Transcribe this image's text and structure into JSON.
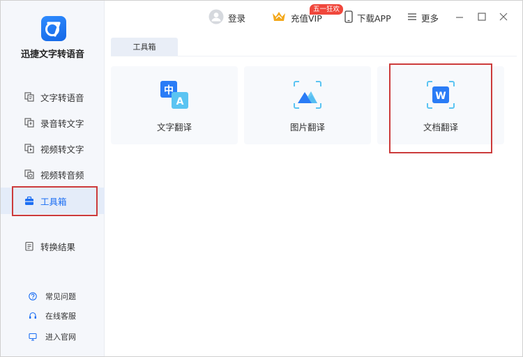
{
  "app": {
    "name": "迅捷文字转语音"
  },
  "sidebar": {
    "items": [
      {
        "label": "文字转语音",
        "icon": "text-to-speech-icon"
      },
      {
        "label": "录音转文字",
        "icon": "recording-to-text-icon"
      },
      {
        "label": "视频转文字",
        "icon": "video-to-text-icon"
      },
      {
        "label": "视频转音频",
        "icon": "video-to-audio-icon"
      },
      {
        "label": "工具箱",
        "icon": "toolbox-icon",
        "active": true
      },
      {
        "label": "转换结果",
        "icon": "conversion-result-icon"
      }
    ],
    "help": [
      {
        "label": "常见问题",
        "icon": "question-icon"
      },
      {
        "label": "在线客服",
        "icon": "headset-icon"
      },
      {
        "label": "进入官网",
        "icon": "monitor-icon"
      }
    ]
  },
  "header": {
    "login": "登录",
    "vip": "充值VIP",
    "promo_badge": "五一狂欢",
    "download": "下载APP",
    "more": "更多"
  },
  "tabs": [
    {
      "label": "工具箱"
    }
  ],
  "tools": [
    {
      "label": "文字翻译",
      "icon": "text-translate-icon",
      "glyph_top": "中",
      "glyph_bottom": "A"
    },
    {
      "label": "图片翻译",
      "icon": "image-translate-icon"
    },
    {
      "label": "文档翻译",
      "icon": "document-translate-icon",
      "glyph": "W"
    }
  ],
  "colors": {
    "accent": "#1b6ef3",
    "highlight": "#cc3b3b",
    "promo": "#f0473c",
    "sidebar_bg": "#f5f7fb"
  }
}
